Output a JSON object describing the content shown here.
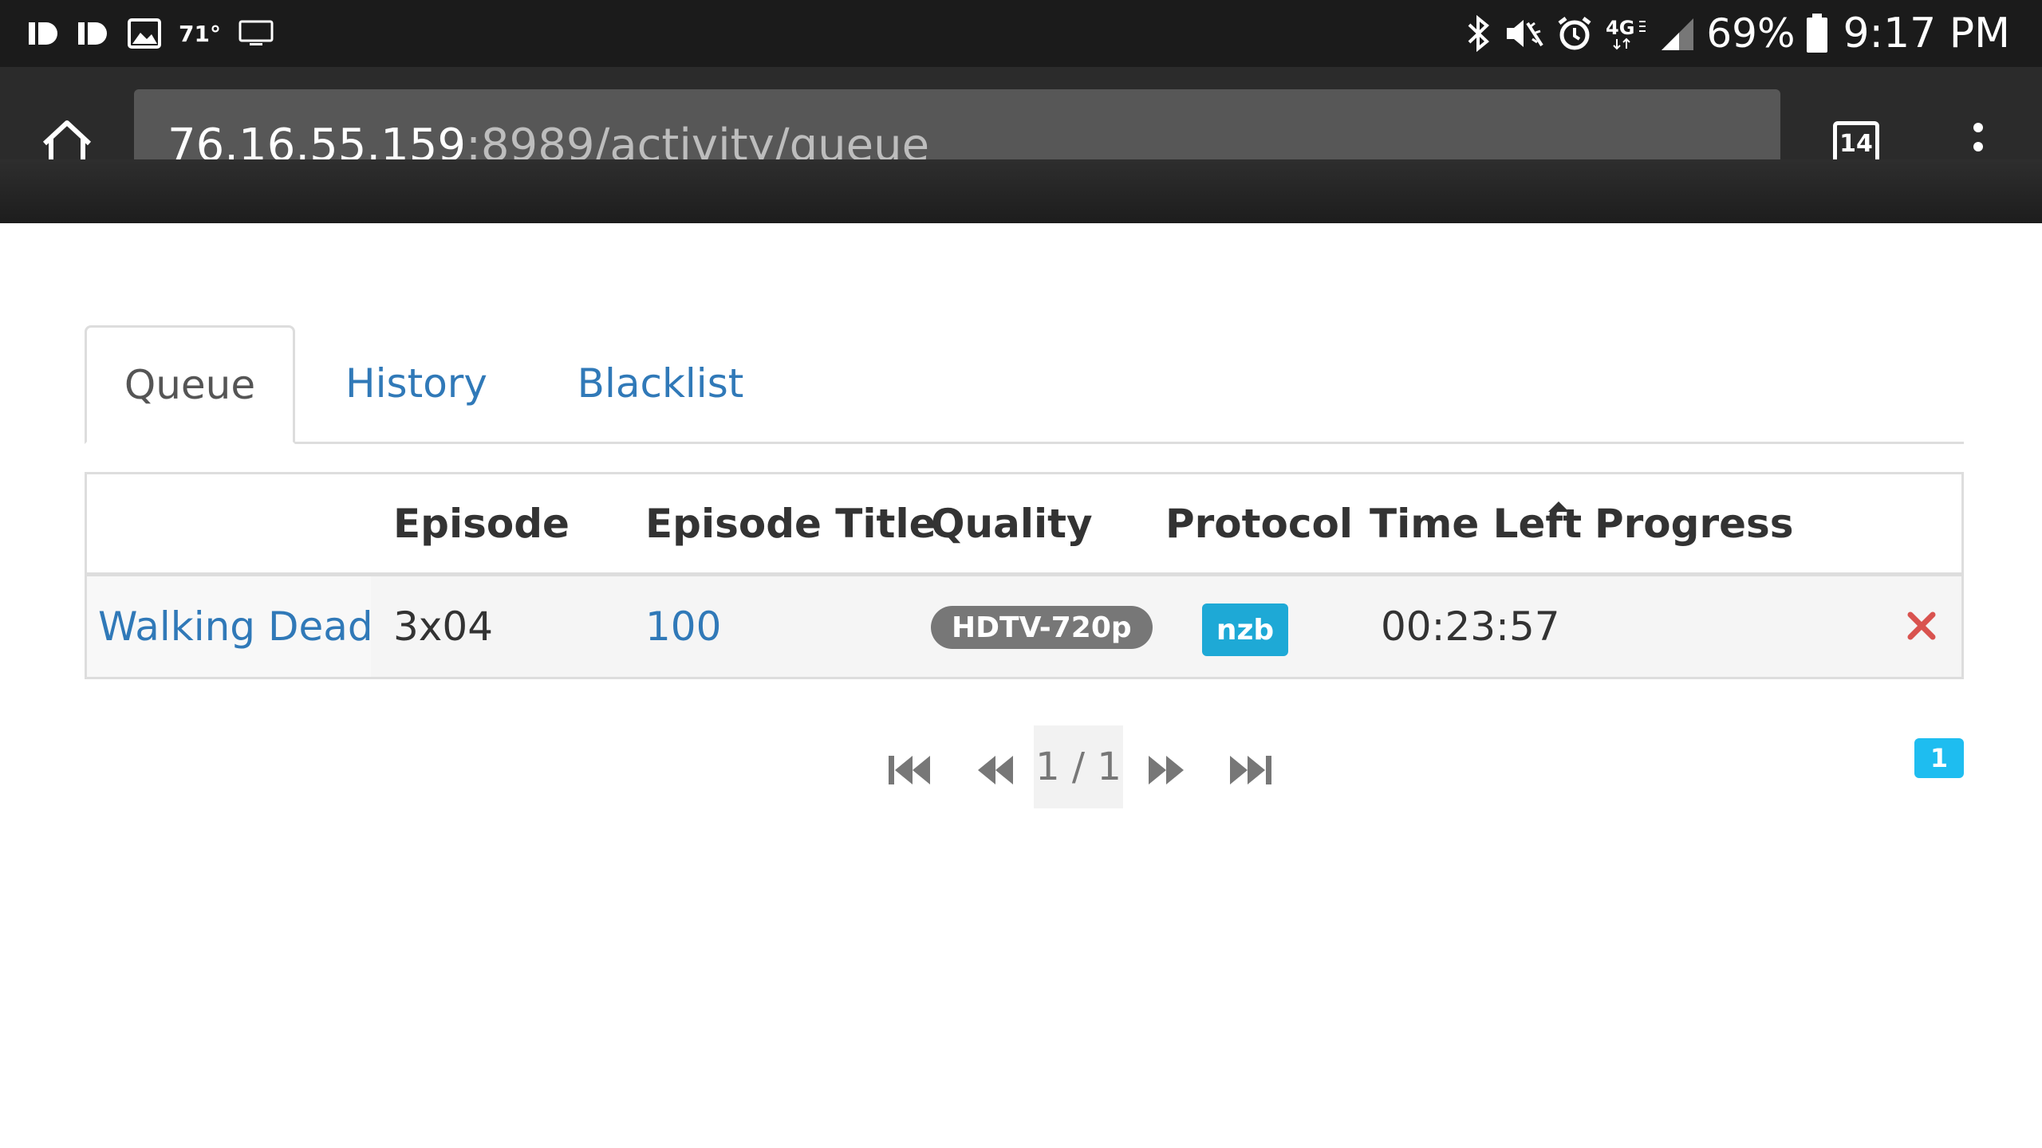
{
  "status_bar": {
    "weather": "71°",
    "battery": "69%",
    "time": "9:17 PM",
    "network": "4G"
  },
  "browser": {
    "url_host": "76.16.55.159",
    "url_rest": ":8989/activity/queue",
    "tab_count": "14"
  },
  "tabs": [
    {
      "label": "Queue",
      "active": true
    },
    {
      "label": "History",
      "active": false
    },
    {
      "label": "Blacklist",
      "active": false
    }
  ],
  "table": {
    "columns": [
      "Episode",
      "Episode Title",
      "Quality",
      "Protocol",
      "Time Left",
      "Progress"
    ],
    "rows": [
      {
        "series": "Walking Dead",
        "episode": "3x04",
        "episode_title": "100",
        "quality": "HDTV-720p",
        "protocol": "nzb",
        "time_left": "00:23:57"
      }
    ]
  },
  "pager": {
    "indicator": "1 / 1",
    "total_count": "1"
  },
  "colors": {
    "link": "#3079b8",
    "protocol_badge": "#1ea9d6",
    "remove": "#d9534f"
  }
}
